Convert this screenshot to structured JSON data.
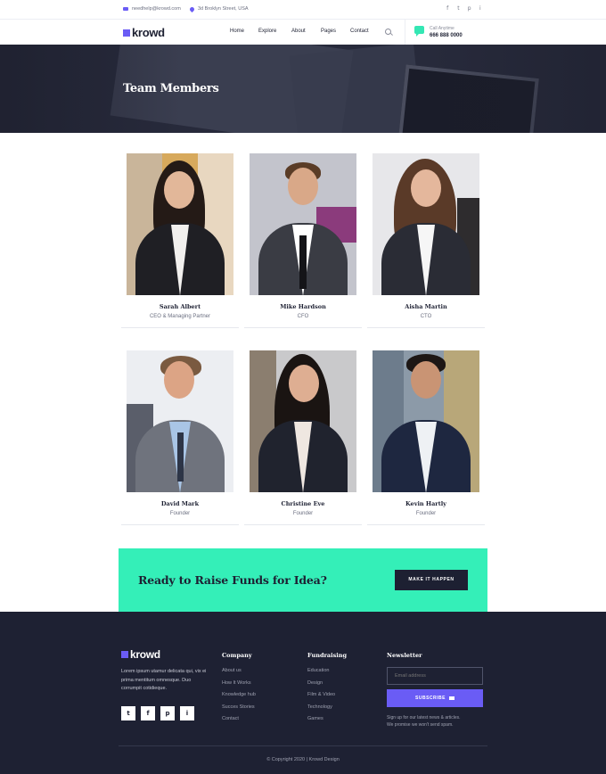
{
  "topbar": {
    "email": "needhelp@krowd.com",
    "address": "3d Broklyn Street, USA",
    "socials": [
      "f",
      "t",
      "p",
      "i"
    ]
  },
  "nav": {
    "logo": "krowd",
    "menu": [
      "Home",
      "Explore",
      "About",
      "Pages",
      "Contact"
    ],
    "call_label": "Call Anytime",
    "phone": "666 888 0000"
  },
  "hero": {
    "title": "Team Members"
  },
  "team": [
    {
      "name": "Sarah Albert",
      "role": "CEO & Managing Partner"
    },
    {
      "name": "Mike Hardson",
      "role": "CFO"
    },
    {
      "name": "Aisha Martin",
      "role": "CTO"
    },
    {
      "name": "David Mark",
      "role": "Founder"
    },
    {
      "name": "Christine Eve",
      "role": "Founder"
    },
    {
      "name": "Kevin Hartly",
      "role": "Founder"
    }
  ],
  "cta": {
    "title": "Ready to Raise Funds for Idea?",
    "button": "MAKE IT HAPPEN"
  },
  "footer": {
    "logo": "krowd",
    "about": "Lorem ipsum utamur delicata qui, vix ei prima mentitum omnesque. Duo corrumpit cotidieque.",
    "socials": [
      "t",
      "f",
      "p",
      "i"
    ],
    "company": {
      "title": "Company",
      "links": [
        "About us",
        "How It Works",
        "Knowledge hub",
        "Succes Stories",
        "Contact"
      ]
    },
    "fundraising": {
      "title": "Fundraising",
      "links": [
        "Education",
        "Design",
        "Film & Video",
        "Technology",
        "Games"
      ]
    },
    "newsletter": {
      "title": "Newsletter",
      "placeholder": "Email address",
      "button": "SUBSCRIBE",
      "note1": "Sign up for our latest news & articles.",
      "note2": "We promise we won't send spam."
    },
    "copyright": "© Copyright 2020 | Krowd Design"
  },
  "colors": {
    "accent": "#6a5cf5",
    "mint": "#34efb8",
    "dark": "#1e2133"
  }
}
